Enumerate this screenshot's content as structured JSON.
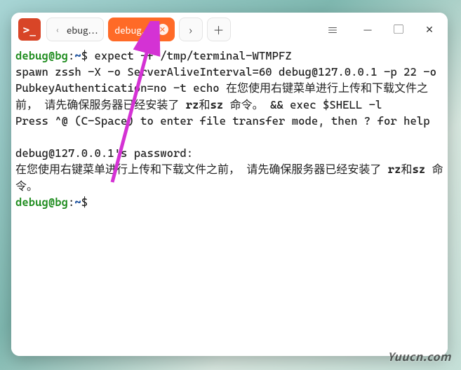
{
  "app": {
    "icon_glyph": ">_"
  },
  "tabs": {
    "prev_chevron": "‹",
    "inactive_label": "ebug…",
    "active_label": "debug…",
    "next_chevron": "›",
    "add_glyph": "＋"
  },
  "window_controls": {
    "menu_glyph": "≡",
    "minimize_glyph": "—",
    "maximize_glyph": "▢",
    "close_glyph": "✕"
  },
  "prompt": {
    "user": "debug",
    "at": "@",
    "host": "bg",
    "sep": ":",
    "path": "~",
    "dollar": "$"
  },
  "lines": {
    "cmd1": " expect -f /tmp/terminal-WTMPFZ",
    "spawn": "spawn zssh -X -o ServerAliveInterval=60 debug@127.0.0.1 -p 22 -o PubkeyAuthentication=no -t echo 在您使用右键菜单进行上传和下载文件之前， 请先确保服务器已经安装了 ",
    "rz_sz_1a": "rz",
    "and1": "和",
    "rz_sz_1b": "sz",
    "spawn_tail": " 命令。 && exec $SHELL -l",
    "press": "Press ^@ (C-Space) to enter file transfer mode, then ? for help",
    "pwd_prompt": "debug@127.0.0.1's password:",
    "msg2": "在您使用右键菜单进行上传和下载文件之前， 请先确保服务器已经安装了 ",
    "rz_sz_2a": "rz",
    "and2": "和",
    "rz_sz_2b": "sz",
    "msg2_tail": " 命令。"
  },
  "watermark": "Yuucn.com"
}
